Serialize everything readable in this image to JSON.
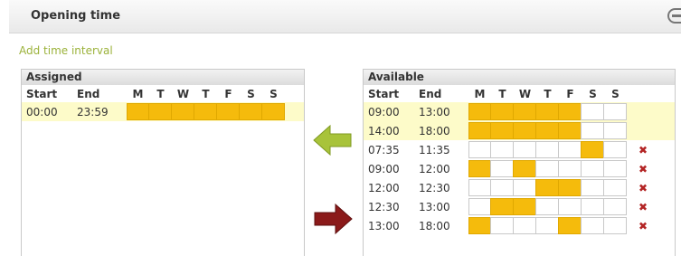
{
  "header": {
    "title": "Opening time"
  },
  "add_interval": "Add time interval",
  "assigned": {
    "title": "Assigned",
    "col_start": "Start",
    "col_end": "End",
    "day_labels": [
      "M",
      "T",
      "W",
      "T",
      "F",
      "S",
      "S"
    ],
    "rows": [
      {
        "start": "00:00",
        "end": "23:59",
        "days": [
          1,
          1,
          1,
          1,
          1,
          1,
          1
        ],
        "highlighted": true
      }
    ]
  },
  "available": {
    "title": "Available",
    "col_start": "Start",
    "col_end": "End",
    "day_labels": [
      "M",
      "T",
      "W",
      "T",
      "F",
      "S",
      "S"
    ],
    "rows": [
      {
        "start": "09:00",
        "end": "13:00",
        "days": [
          1,
          1,
          1,
          1,
          1,
          0,
          0
        ],
        "highlighted": true,
        "deletable": false
      },
      {
        "start": "14:00",
        "end": "18:00",
        "days": [
          1,
          1,
          1,
          1,
          1,
          0,
          0
        ],
        "highlighted": true,
        "deletable": false
      },
      {
        "start": "07:35",
        "end": "11:35",
        "days": [
          0,
          0,
          0,
          0,
          0,
          1,
          0
        ],
        "highlighted": false,
        "deletable": true
      },
      {
        "start": "09:00",
        "end": "12:00",
        "days": [
          1,
          0,
          1,
          0,
          0,
          0,
          0
        ],
        "highlighted": false,
        "deletable": true
      },
      {
        "start": "12:00",
        "end": "12:30",
        "days": [
          0,
          0,
          0,
          1,
          1,
          0,
          0
        ],
        "highlighted": false,
        "deletable": true
      },
      {
        "start": "12:30",
        "end": "13:00",
        "days": [
          0,
          1,
          1,
          0,
          0,
          0,
          0
        ],
        "highlighted": false,
        "deletable": true
      },
      {
        "start": "13:00",
        "end": "18:00",
        "days": [
          1,
          0,
          0,
          0,
          1,
          0,
          0
        ],
        "highlighted": false,
        "deletable": true
      }
    ]
  },
  "delete_glyph": "✖",
  "colors": {
    "day_on": "#f5bb0c",
    "row_highlight": "#fdfbc9",
    "link": "#9bb23a",
    "arrow_left": "#a8c33a",
    "arrow_right": "#8b1a1a",
    "delete": "#b32424"
  },
  "icons": {
    "collapse": "minus-circle-icon",
    "assign": "arrow-left-icon",
    "unassign": "arrow-right-icon",
    "delete": "delete-icon"
  }
}
